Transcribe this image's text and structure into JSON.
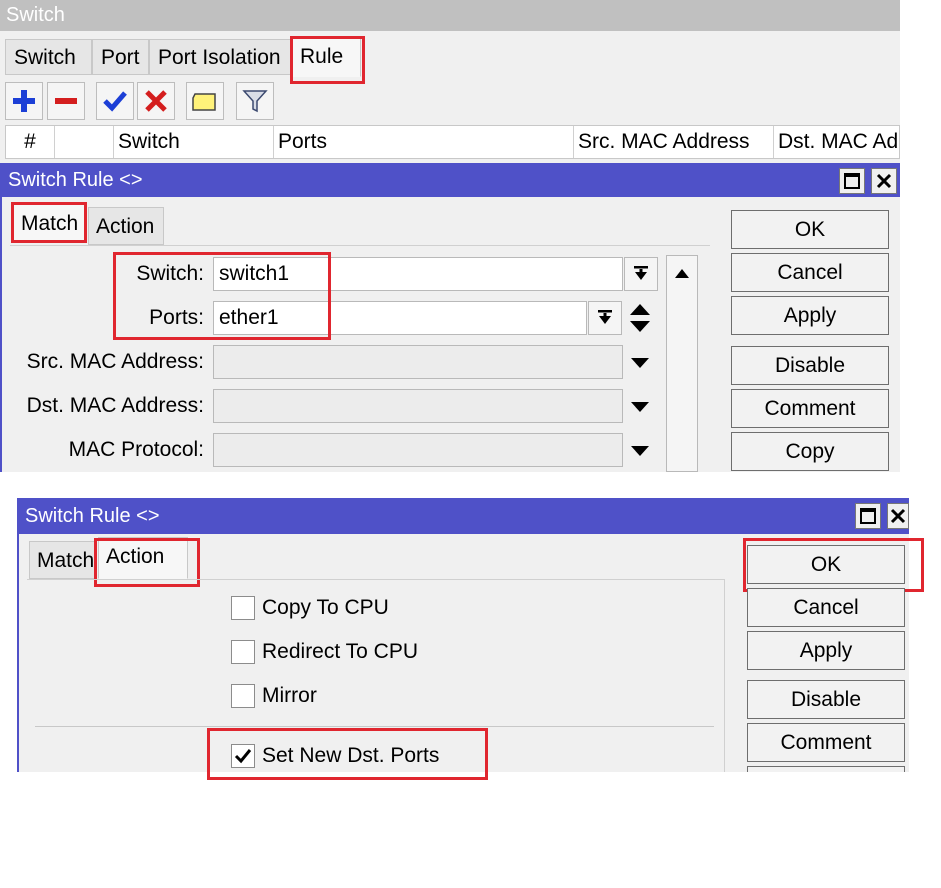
{
  "top_window": {
    "title": "Switch",
    "tabs": [
      "Switch",
      "Port",
      "Port Isolation",
      "Rule"
    ],
    "active_tab": "Rule",
    "toolbar_icons": [
      "add-icon",
      "remove-icon",
      "enable-icon",
      "disable-icon",
      "comment-icon",
      "filter-icon"
    ],
    "columns": [
      "#",
      "",
      "Switch",
      "Ports",
      "Src. MAC Address",
      "Dst. MAC Ad"
    ]
  },
  "match_dialog": {
    "title": "Switch Rule <>",
    "tabs": [
      "Match",
      "Action"
    ],
    "active_tab": "Match",
    "fields": {
      "switch": {
        "label": "Switch:",
        "value": "switch1"
      },
      "ports": {
        "label": "Ports:",
        "value": "ether1"
      },
      "src_mac": {
        "label": "Src. MAC Address:",
        "value": ""
      },
      "dst_mac": {
        "label": "Dst. MAC Address:",
        "value": ""
      },
      "mac_protocol": {
        "label": "MAC Protocol:",
        "value": ""
      }
    },
    "buttons": [
      "OK",
      "Cancel",
      "Apply",
      "Disable",
      "Comment",
      "Copy"
    ]
  },
  "action_dialog": {
    "title": "Switch Rule <>",
    "tabs": [
      "Match",
      "Action"
    ],
    "active_tab": "Action",
    "checkboxes": [
      {
        "label": "Copy To CPU",
        "checked": false
      },
      {
        "label": "Redirect To CPU",
        "checked": false
      },
      {
        "label": "Mirror",
        "checked": false
      },
      {
        "label": "Set New Dst. Ports",
        "checked": true
      }
    ],
    "buttons": [
      "OK",
      "Cancel",
      "Apply",
      "Disable",
      "Comment"
    ]
  },
  "colors": {
    "title_bar": "#4f51c8",
    "inactive_title": "#c0c0c0",
    "highlight": "#e0262f"
  }
}
